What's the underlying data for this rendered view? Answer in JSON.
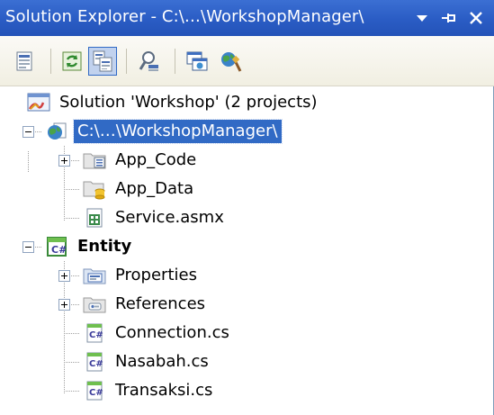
{
  "titlebar": {
    "title": "Solution Explorer - C:\\…\\WorkshopManager\\",
    "buttons": [
      "dropdown-icon",
      "pin-icon",
      "close-icon"
    ]
  },
  "toolbar": {
    "buttons": [
      "properties-icon",
      "refresh-icon",
      "show-all-files-icon",
      "view-class-diagram-icon",
      "copy-website-icon",
      "asp-net-configuration-icon"
    ],
    "active": "show-all-files-icon"
  },
  "tree": {
    "solution": {
      "label": "Solution 'Workshop' (2 projects)",
      "icon": "solution-icon"
    },
    "website": {
      "label": "C:\\…\\WorkshopManager\\",
      "icon": "website-icon",
      "selected": true,
      "expanded": true,
      "children": [
        {
          "label": "App_Code",
          "icon": "special-folder-icon",
          "expandable": true
        },
        {
          "label": "App_Data",
          "icon": "data-folder-icon",
          "expandable": false
        },
        {
          "label": "Service.asmx",
          "icon": "web-service-icon",
          "expandable": false
        }
      ]
    },
    "entity": {
      "label": "Entity",
      "icon": "csharp-project-icon",
      "bold": true,
      "expanded": true,
      "children": [
        {
          "label": "Properties",
          "icon": "properties-folder-icon",
          "expandable": true
        },
        {
          "label": "References",
          "icon": "references-folder-icon",
          "expandable": true
        },
        {
          "label": "Connection.cs",
          "icon": "csharp-file-icon",
          "expandable": false
        },
        {
          "label": "Nasabah.cs",
          "icon": "csharp-file-icon",
          "expandable": false
        },
        {
          "label": "Transaksi.cs",
          "icon": "csharp-file-icon",
          "expandable": false
        }
      ]
    }
  },
  "colors": {
    "titlebar": "#2a5cc4",
    "selection": "#316ac5",
    "toolbar": "#f1efe2",
    "tree_lines": "#a0a0a0"
  }
}
